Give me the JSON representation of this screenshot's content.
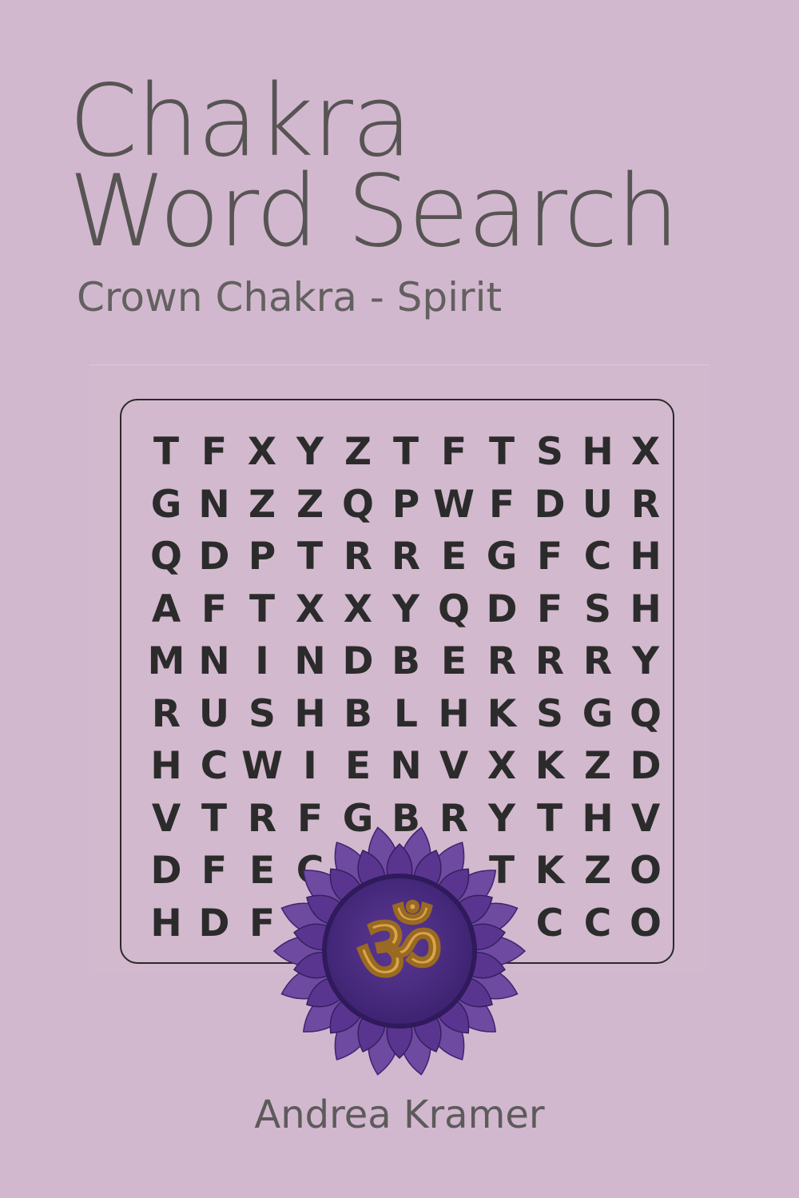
{
  "colors": {
    "background": "#d2b8ce",
    "title_text": "#575454",
    "subtitle_text": "#636060",
    "grid_letters": "#2b2b2b",
    "grid_border": "#2a2a2a",
    "emblem_petal_outer": "#6e4aa0",
    "emblem_petal_inner": "#5a3590",
    "emblem_center": "#4a2c80",
    "emblem_symbol": "#d8a548",
    "author_text": "#5d5a5b"
  },
  "cover": {
    "title_line_1": "Chakra",
    "title_line_2": "Word Search",
    "subtitle": "Crown Chakra - Spirit",
    "author": "Andrea Kramer"
  },
  "word_search": {
    "rows": [
      [
        "T",
        "F",
        "X",
        "Y",
        "Z",
        "T",
        "F",
        "T",
        "S",
        "H",
        "X"
      ],
      [
        "G",
        "N",
        "Z",
        "Z",
        "Q",
        "P",
        "W",
        "F",
        "D",
        "U",
        "R"
      ],
      [
        "Q",
        "D",
        "P",
        "T",
        "R",
        "R",
        "E",
        "G",
        "F",
        "C",
        "H"
      ],
      [
        "A",
        "F",
        "T",
        "X",
        "X",
        "Y",
        "Q",
        "D",
        "F",
        "S",
        "H"
      ],
      [
        "M",
        "N",
        "I",
        "N",
        "D",
        "B",
        "E",
        "R",
        "R",
        "R",
        "Y"
      ],
      [
        "R",
        "U",
        "S",
        "H",
        "B",
        "L",
        "H",
        "K",
        "S",
        "G",
        "Q"
      ],
      [
        "H",
        "C",
        "W",
        "I",
        "E",
        "N",
        "V",
        "X",
        "K",
        "Z",
        "D"
      ],
      [
        "V",
        "T",
        "R",
        "F",
        "G",
        "B",
        "R",
        "Y",
        "T",
        "H",
        "V"
      ],
      [
        "D",
        "F",
        "E",
        "C",
        "",
        "",
        "",
        "T",
        "K",
        "Z",
        "O"
      ],
      [
        "H",
        "D",
        "F",
        "",
        "",
        "",
        "",
        "",
        "C",
        "C",
        "O"
      ]
    ]
  },
  "emblem": {
    "icon": "om-icon",
    "symbol": "ॐ"
  }
}
